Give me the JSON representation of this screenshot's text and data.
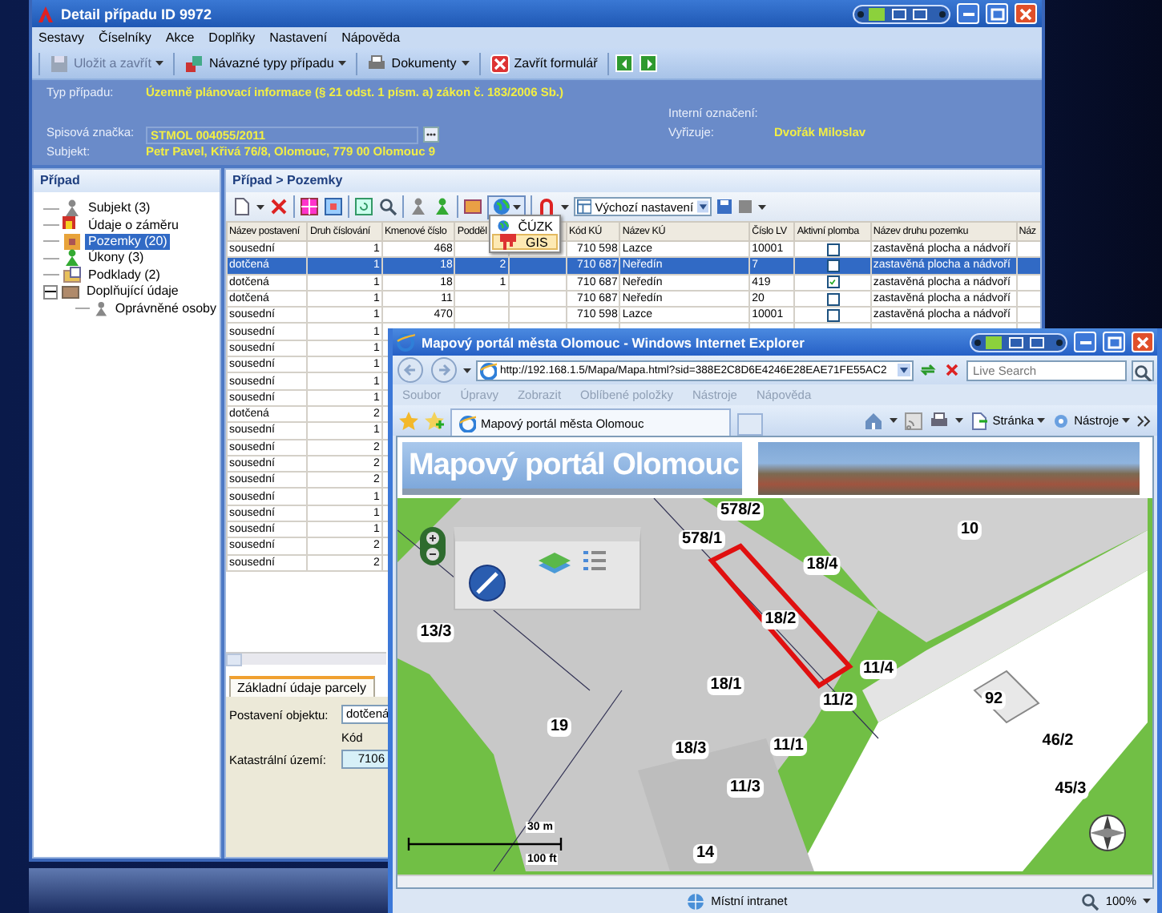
{
  "main_window": {
    "title": "Detail případu ID 9972",
    "menu": [
      "Sestavy",
      "Číselníky",
      "Akce",
      "Doplňky",
      "Nastavení",
      "Nápověda"
    ],
    "toolbar": [
      {
        "label": "Uložit a zavřít",
        "disabled": true,
        "dropdown": true
      },
      {
        "label": "Návazné typy případu",
        "disabled": false,
        "dropdown": true
      },
      {
        "label": "Dokumenty",
        "disabled": false,
        "dropdown": true
      },
      {
        "label": "Zavřít formulář",
        "disabled": false,
        "dropdown": false
      }
    ],
    "case_info": {
      "type": {
        "label": "Typ případu:",
        "value": "Územně plánovací informace (§ 21 odst. 1 písm. a) zákon č. 183/2006 Sb.)"
      },
      "internal_id": {
        "label": "Interní označení:"
      },
      "file_no": {
        "label": "Spisová značka:",
        "value": "STMOL 004055/2011"
      },
      "handler": {
        "label": "Vyřizuje:",
        "value": "Dvořák Miloslav"
      },
      "subject": {
        "label": "Subjekt:",
        "value": "Petr Pavel, Křivá 76/8, Olomouc, 779 00  Olomouc 9"
      }
    },
    "tree": {
      "title": "Případ",
      "items": [
        {
          "label": "Subjekt (3)",
          "selected": false
        },
        {
          "label": "Údaje o záměru",
          "selected": false
        },
        {
          "label": "Pozemky (20)",
          "selected": true
        },
        {
          "label": "Úkony (3)",
          "selected": false
        },
        {
          "label": "Podklady (2)",
          "selected": false
        },
        {
          "label": "Doplňující údaje",
          "selected": false,
          "expanded": true,
          "children": [
            {
              "label": "Oprávněné osoby",
              "selected": false
            }
          ]
        }
      ]
    },
    "pane": {
      "title": "Případ > Pozemky",
      "view_select": "Výchozí nastavení",
      "map_menu": [
        {
          "label": "ČÚZK",
          "selected": false
        },
        {
          "label": "GIS",
          "selected": true
        }
      ],
      "columns": [
        "Název postavení",
        "Druh číslování",
        "Kmenové číslo",
        "Podděl",
        null,
        "Kód KÚ",
        "Název KÚ",
        "Číslo LV",
        "Aktivní plomba",
        "Název druhu pozemku",
        "Náz"
      ],
      "rows": [
        {
          "selected": false,
          "seal_checked": false,
          "cells": [
            "sousední",
            "1",
            "468",
            null,
            null,
            "710 598",
            "Lazce",
            "10001",
            null,
            "zastavěná plocha a nádvoří"
          ]
        },
        {
          "selected": true,
          "seal_checked": false,
          "cells": [
            "dotčená",
            "1",
            "18",
            "2",
            null,
            "710 687",
            "Neředín",
            "7",
            null,
            "zastavěná plocha a nádvoří"
          ]
        },
        {
          "selected": false,
          "seal_checked": true,
          "cells": [
            "dotčená",
            "1",
            "18",
            "1",
            null,
            "710 687",
            "Neředín",
            "419",
            null,
            "zastavěná plocha a nádvoří"
          ]
        },
        {
          "selected": false,
          "seal_checked": false,
          "cells": [
            "dotčená",
            "1",
            "11",
            null,
            null,
            "710 687",
            "Neředín",
            "20",
            null,
            "zastavěná plocha a nádvoří"
          ]
        },
        {
          "selected": false,
          "seal_checked": false,
          "cells": [
            "sousední",
            "1",
            "470",
            null,
            null,
            "710 598",
            "Lazce",
            "10001",
            null,
            "zastavěná plocha a nádvoří"
          ]
        },
        {
          "selected": false,
          "cells": [
            "sousední",
            "1"
          ]
        },
        {
          "selected": false,
          "cells": [
            "sousední",
            "1"
          ]
        },
        {
          "selected": false,
          "cells": [
            "sousední",
            "1"
          ]
        },
        {
          "selected": false,
          "cells": [
            "sousední",
            "1"
          ]
        },
        {
          "selected": false,
          "cells": [
            "sousední",
            "1"
          ]
        },
        {
          "selected": false,
          "cells": [
            "dotčená",
            "2"
          ]
        },
        {
          "selected": false,
          "cells": [
            "sousední",
            "1"
          ]
        },
        {
          "selected": false,
          "cells": [
            "sousední",
            "2"
          ]
        },
        {
          "selected": false,
          "cells": [
            "sousední",
            "2"
          ]
        },
        {
          "selected": false,
          "cells": [
            "sousední",
            "2"
          ]
        },
        {
          "selected": false,
          "cells": [
            "sousední",
            "1"
          ]
        },
        {
          "selected": false,
          "cells": [
            "sousední",
            "1"
          ]
        },
        {
          "selected": false,
          "cells": [
            "sousední",
            "1"
          ]
        },
        {
          "selected": false,
          "cells": [
            "sousední",
            "2"
          ]
        },
        {
          "selected": false,
          "cells": [
            "sousední",
            "2"
          ]
        }
      ],
      "detail_tabs": [
        {
          "label": "Základní údaje parcely",
          "selected": true
        }
      ],
      "detail": {
        "position": {
          "label": "Postavení objektu:",
          "value": "dotčená"
        },
        "code_caption": "Kód",
        "cadastre": {
          "label": "Katastrální území:",
          "value": "7106"
        }
      }
    }
  },
  "browser": {
    "title": "Mapový portál města Olomouc - Windows Internet Explorer",
    "address": "http://192.168.1.5/Mapa/Mapa.html?sid=388E2C8D6E4246E28EAE71FE55AC2",
    "search": {
      "placeholder": "Live Search"
    },
    "menu": [
      "Soubor",
      "Úpravy",
      "Zobrazit",
      "Oblíbené položky",
      "Nástroje",
      "Nápověda"
    ],
    "tabs": [
      {
        "label": "Mapový portál města Olomouc",
        "selected": true
      }
    ],
    "commands": [
      "Stránka",
      "Nástroje"
    ],
    "banner_title": "Mapový portál Olomouc",
    "parcels": [
      {
        "label": "578/2",
        "selected": false
      },
      {
        "label": "578/1",
        "selected": false
      },
      {
        "label": "10",
        "selected": false
      },
      {
        "label": "18/4",
        "selected": false
      },
      {
        "label": "13/3",
        "selected": false
      },
      {
        "label": "18/2",
        "selected": true
      },
      {
        "label": "18/1",
        "selected": false
      },
      {
        "label": "11/4",
        "selected": false
      },
      {
        "label": "11/2",
        "selected": false
      },
      {
        "label": "92",
        "selected": false
      },
      {
        "label": "19",
        "selected": false
      },
      {
        "label": "18/3",
        "selected": false
      },
      {
        "label": "11/1",
        "selected": false
      },
      {
        "label": "46/2",
        "selected": false
      },
      {
        "label": "11/3",
        "selected": false
      },
      {
        "label": "45/3",
        "selected": false
      },
      {
        "label": "14",
        "selected": false
      }
    ],
    "scale": {
      "metric": "30 m",
      "imperial": "100 ft"
    },
    "status": {
      "zone": "Místní intranet",
      "zoom": "100%"
    }
  }
}
